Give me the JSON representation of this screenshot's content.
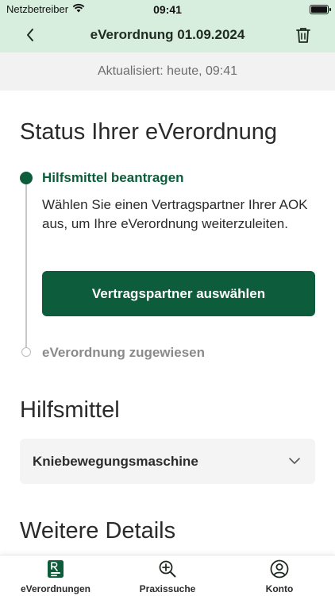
{
  "status_bar": {
    "carrier": "Netzbetreiber",
    "time": "09:41"
  },
  "nav": {
    "title": "eVerordnung 01.09.2024"
  },
  "updated": {
    "text": "Aktualisiert: heute, 09:41"
  },
  "status_section": {
    "title": "Status Ihrer eVerordnung",
    "steps": [
      {
        "title": "Hilfsmittel beantragen",
        "description": "Wählen Sie einen Vertragspartner Ihrer AOK aus, um Ihre eVerordnung weiterzuleiten.",
        "button_label": "Vertragspartner auswählen"
      },
      {
        "title": "eVerordnung zugewiesen"
      }
    ]
  },
  "hilfsmittel_section": {
    "title": "Hilfsmittel",
    "selected_item": "Kniebewegungsmaschine"
  },
  "details_section": {
    "title": "Weitere Details"
  },
  "tab_bar": {
    "tabs": [
      {
        "label": "eVerordnungen",
        "icon": "document-prescription-icon",
        "active": true
      },
      {
        "label": "Praxissuche",
        "icon": "search-plus-icon",
        "active": false
      },
      {
        "label": "Konto",
        "icon": "account-icon",
        "active": false
      }
    ]
  },
  "colors": {
    "accent": "#0d5c3b",
    "header_bg": "#d7eddd",
    "inactive": "#8a8a8a"
  }
}
